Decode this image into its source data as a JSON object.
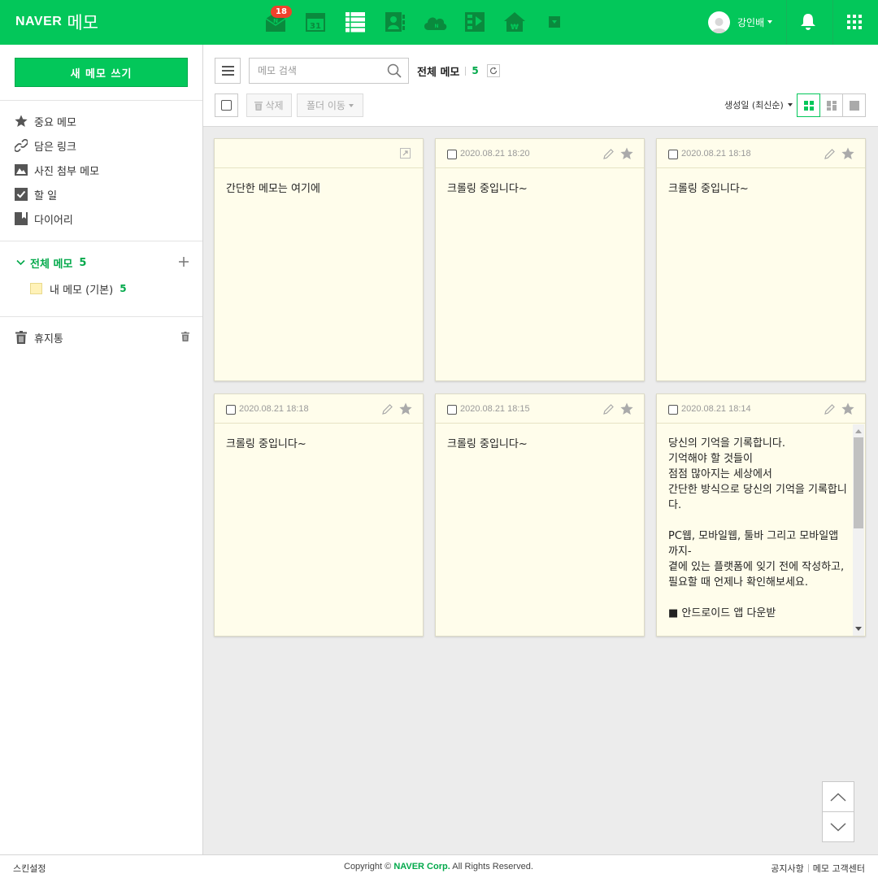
{
  "brand": {
    "naver": "NAVER",
    "memo": "메모"
  },
  "top_apps": [
    {
      "icon": "mail-icon",
      "badge": "18"
    },
    {
      "icon": "calendar-icon",
      "label": "31"
    },
    {
      "icon": "memo-list-icon"
    },
    {
      "icon": "contacts-icon"
    },
    {
      "icon": "cloud-icon"
    },
    {
      "icon": "office-icon"
    },
    {
      "icon": "home-icon"
    },
    {
      "icon": "more-apps-icon"
    }
  ],
  "user": {
    "name": "강인배"
  },
  "sidebar": {
    "new_memo": "새 메모 쓰기",
    "items": [
      {
        "label": "중요 메모",
        "icon": "star-icon"
      },
      {
        "label": "담은 링크",
        "icon": "link-icon"
      },
      {
        "label": "사진 첨부 메모",
        "icon": "photo-icon"
      },
      {
        "label": "할 일",
        "icon": "checkbox-icon"
      },
      {
        "label": "다이어리",
        "icon": "bookmark-icon"
      }
    ],
    "all_folder": {
      "label": "전체 메모",
      "count": "5"
    },
    "sub_folder": {
      "label": "내 메모 (기본)",
      "count": "5"
    },
    "trash": {
      "label": "휴지통"
    }
  },
  "toolbar": {
    "search_placeholder": "메모 검색",
    "breadcrumb": "전체 메모",
    "count": "5",
    "delete": "삭제",
    "move_folder": "폴더 이동",
    "sort": "생성일 (최신순)"
  },
  "cards": [
    {
      "date": "",
      "body": "간단한 메모는 여기에"
    },
    {
      "date": "2020.08.21 18:20",
      "body": "크롤링 중입니다~"
    },
    {
      "date": "2020.08.21 18:18",
      "body": "크롤링 중입니다~"
    },
    {
      "date": "2020.08.21 18:18",
      "body": "크롤링 중입니다~"
    },
    {
      "date": "2020.08.21 18:15",
      "body": "크롤링 중입니다~"
    },
    {
      "date": "2020.08.21 18:14",
      "body": "당신의 기억을 기록합니다.\n기억해야 할 것들이\n점점 많아지는 세상에서\n간단한 방식으로 당신의 기억을 기록합니다.\n\nPC웹, 모바일웹, 툴바 그리고 모바일앱까지-\n곁에 있는 플랫폼에 잊기 전에 작성하고,\n필요할 때 언제나 확인해보세요.\n\n■ 안드로이드 앱 다운받"
    }
  ],
  "footer": {
    "skin": "스킨설정",
    "copyright_prefix": "Copyright ©",
    "copyright_brand": "NAVER Corp.",
    "copyright_suffix": "All Rights Reserved.",
    "notice": "공지사항",
    "support": "메모 고객센터"
  },
  "colors": {
    "brand": "#03c75a",
    "memo_bg": "#fffdeb",
    "accent_text": "#03a94b"
  }
}
